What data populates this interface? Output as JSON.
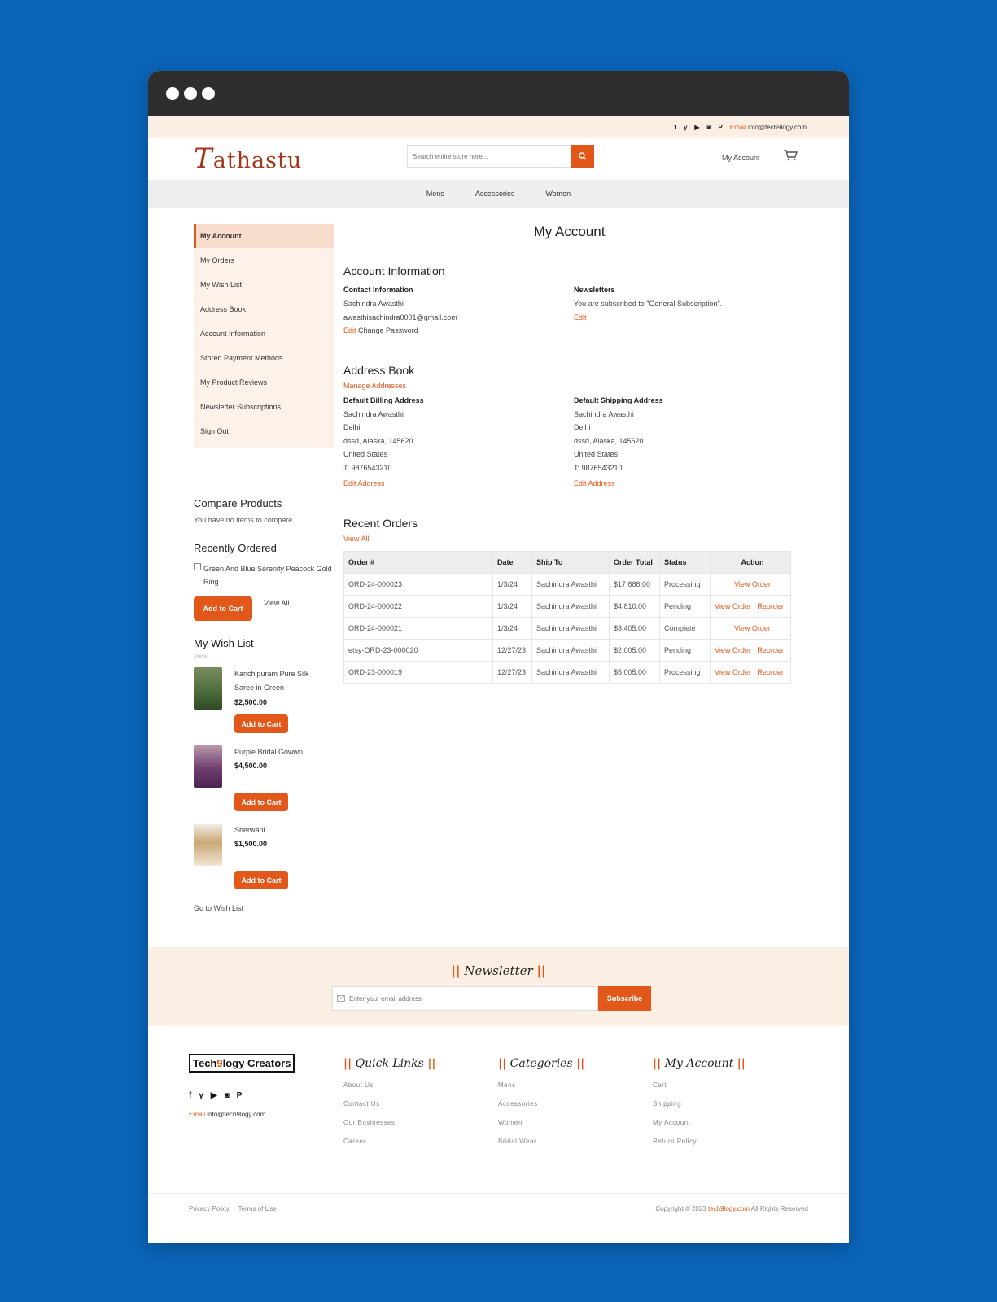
{
  "topbar": {
    "socials": [
      "f",
      "y",
      "▶",
      "◙",
      "P"
    ],
    "email_label": "Email",
    "email": "info@tech9logy.com"
  },
  "header": {
    "logo_initial": "T",
    "logo_rest": "athastu",
    "search_placeholder": "Search entire store here...",
    "my_account": "My Account"
  },
  "nav": [
    "Mens",
    "Accessories",
    "Women"
  ],
  "sidebar": {
    "menu": [
      "My Account",
      "My Orders",
      "My Wish List",
      "Address Book",
      "Account Information",
      "Stored Payment Methods",
      "My Product Reviews",
      "Newsletter Subscriptions",
      "Sign Out"
    ],
    "compare_title": "Compare Products",
    "compare_text": "You have no items to compare.",
    "recent_title": "Recently Ordered",
    "recent_item": "Green And Blue Serenity Peacock Gold Ring",
    "add_to_cart": "Add to Cart",
    "view_all": "View All",
    "wish_title": "My Wish List",
    "wish_count": "3 items",
    "wish_items": [
      {
        "name": "Kanchipuram Pure Silk Saree in Green",
        "price": "$2,500.00",
        "color": "#4b6b3a"
      },
      {
        "name": "Purple Bridal Gowwn",
        "price": "$4,500.00",
        "color": "#6f3c70"
      },
      {
        "name": "Sherwani",
        "price": "$1,500.00",
        "color": "#caa777"
      }
    ],
    "go_to_wishlist": "Go to Wish List"
  },
  "main": {
    "page_title": "My Account",
    "account_info_title": "Account Information",
    "contact_title": "Contact Information",
    "contact_name": "Sachindra Awasthi",
    "contact_email": "awasthisachindra0001@gmail.com",
    "edit": "Edit",
    "change_password": "Change Password",
    "newsletters_title": "Newsletters",
    "newsletters_text": "You are subscribed to \"General Subscription\".",
    "address_book_title": "Address Book",
    "manage_addresses": "Manage Addresses",
    "billing_title": "Default Billing Address",
    "shipping_title": "Default Shipping Address",
    "billing": [
      "Sachindra Awasthi",
      "Delhi",
      "dssd, Alaska, 145620",
      "United States",
      "T: 9876543210"
    ],
    "shipping": [
      "Sachindra Awasthi",
      "Delhi",
      "dssd, Alaska, 145620",
      "United States",
      "T: 9876543210"
    ],
    "edit_address": "Edit Address",
    "recent_orders_title": "Recent Orders",
    "view_all": "View All",
    "orders_headers": [
      "Order #",
      "Date",
      "Ship To",
      "Order Total",
      "Status",
      "Action"
    ],
    "orders": [
      {
        "id": "ORD-24-000023",
        "date": "1/3/24",
        "ship_to": "Sachindra Awasthi",
        "total": "$17,686.00",
        "status": "Processing",
        "view": "View Order",
        "reorder": ""
      },
      {
        "id": "ORD-24-000022",
        "date": "1/3/24",
        "ship_to": "Sachindra Awasthi",
        "total": "$4,810.00",
        "status": "Pending",
        "view": "View Order",
        "reorder": "Reorder"
      },
      {
        "id": "ORD-24-000021",
        "date": "1/3/24",
        "ship_to": "Sachindra Awasthi",
        "total": "$3,405.00",
        "status": "Complete",
        "view": "View Order",
        "reorder": ""
      },
      {
        "id": "etsy-ORD-23-000020",
        "date": "12/27/23",
        "ship_to": "Sachindra Awasthi",
        "total": "$2,005.00",
        "status": "Pending",
        "view": "View Order",
        "reorder": "Reorder"
      },
      {
        "id": "ORD-23-000019",
        "date": "12/27/23",
        "ship_to": "Sachindra Awasthi",
        "total": "$5,005.00",
        "status": "Processing",
        "view": "View Order",
        "reorder": "Reorder"
      }
    ]
  },
  "newsletter": {
    "title": "Newsletter",
    "placeholder": "Enter your email address",
    "subscribe": "Subscribe"
  },
  "footer": {
    "brand_a": "Tech",
    "brand_nine": "9",
    "brand_b": "logy Creators",
    "email_label": "Email",
    "email": "info@tech9logy.com",
    "quick_links_title": "Quick Links",
    "quick_links": [
      "About Us",
      "Contact Us",
      "Our Businesses",
      "Career"
    ],
    "categories_title": "Categories",
    "categories": [
      "Mens",
      "Accessories",
      "Women",
      "Bridal Wear"
    ],
    "account_title": "My Account",
    "account_links": [
      "Cart",
      "Shipping",
      "My Account",
      "Return Policy"
    ],
    "privacy": "Privacy Policy",
    "terms": "Terms of Use",
    "copyright_pre": "Copyright © 2023",
    "copyright_brand": "tech9logy.com",
    "copyright_post": "All Rights Reserved"
  }
}
